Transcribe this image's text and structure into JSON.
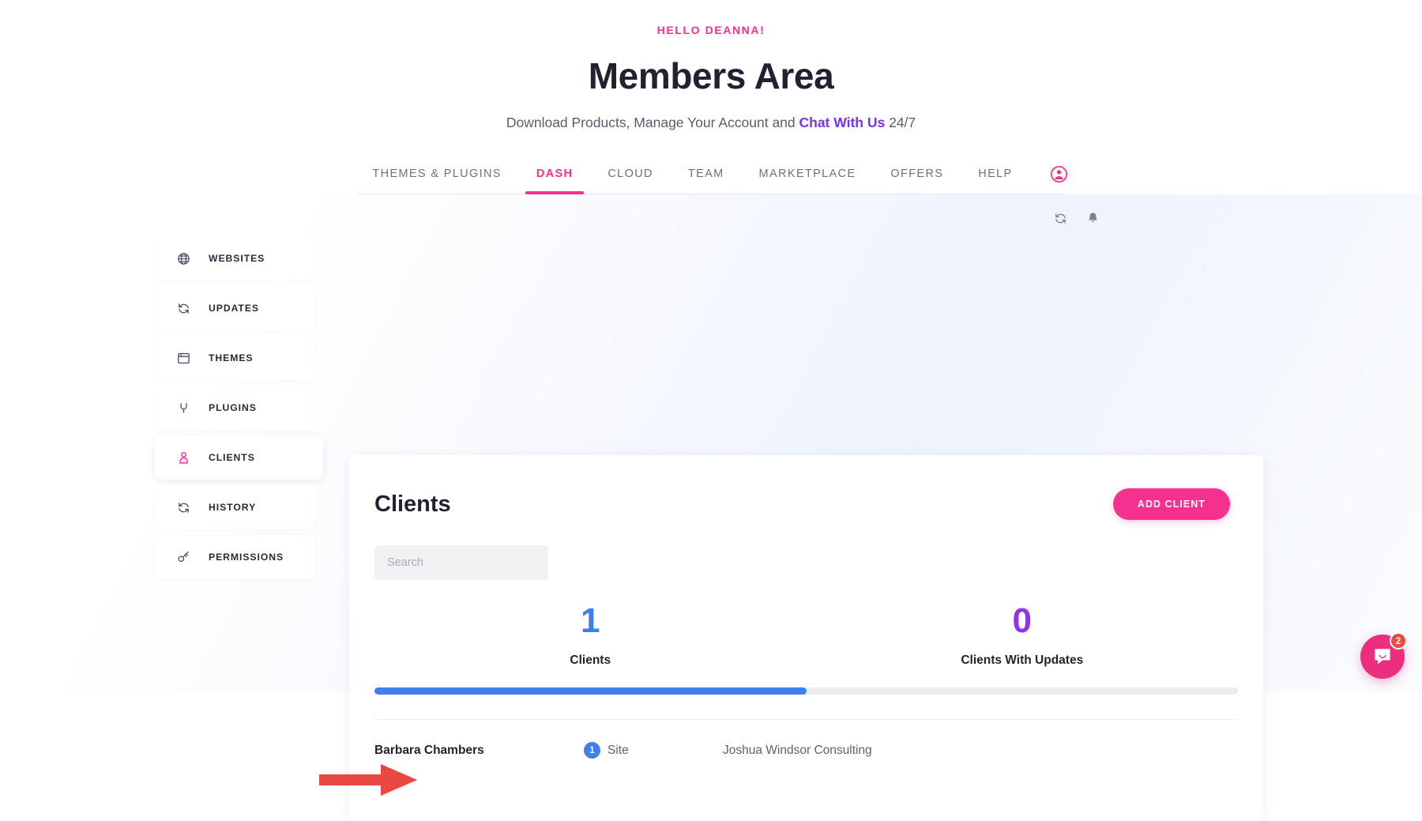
{
  "hero": {
    "greeting": "HELLO DEANNA!",
    "title": "Members Area",
    "subtitle_before": "Download Products, Manage Your Account and ",
    "chat_link": "Chat With Us",
    "subtitle_after": " 24/7"
  },
  "nav": {
    "tabs": [
      {
        "label": "THEMES & PLUGINS",
        "active": false
      },
      {
        "label": "DASH",
        "active": true
      },
      {
        "label": "CLOUD",
        "active": false
      },
      {
        "label": "TEAM",
        "active": false
      },
      {
        "label": "MARKETPLACE",
        "active": false
      },
      {
        "label": "OFFERS",
        "active": false
      },
      {
        "label": "HELP",
        "active": false
      }
    ],
    "avatar_icon": "account-circle-icon"
  },
  "toolbar": {
    "refresh_icon": "refresh-icon",
    "notifications_icon": "bell-icon"
  },
  "sidebar": {
    "items": [
      {
        "label": "WEBSITES",
        "icon": "globe-icon",
        "active": false
      },
      {
        "label": "UPDATES",
        "icon": "refresh-icon",
        "active": false
      },
      {
        "label": "THEMES",
        "icon": "window-icon",
        "active": false
      },
      {
        "label": "PLUGINS",
        "icon": "plug-icon",
        "active": false
      },
      {
        "label": "CLIENTS",
        "icon": "person-icon",
        "active": true
      },
      {
        "label": "HISTORY",
        "icon": "refresh-icon",
        "active": false
      },
      {
        "label": "PERMISSIONS",
        "icon": "key-icon",
        "active": false
      }
    ]
  },
  "main": {
    "title": "Clients",
    "add_button": "ADD CLIENT",
    "search_placeholder": "Search",
    "search_value": "",
    "stats": [
      {
        "value": "1",
        "label": "Clients",
        "color": "#3b7ff0"
      },
      {
        "value": "0",
        "label": "Clients With Updates",
        "color": "#9333e8"
      }
    ],
    "progress_percent": 50,
    "clients": [
      {
        "name": "Barbara Chambers",
        "site_count": "1",
        "sites_label": "Site",
        "company": "Joshua Windsor Consulting"
      }
    ]
  },
  "annotation": {
    "arrow_color": "#e8483f",
    "points_at": "Barbara Chambers"
  },
  "chat_widget": {
    "unread_count": "2",
    "icon": "chat-bubble-icon"
  },
  "colors": {
    "brand_pink": "#f5308f",
    "accent_blue": "#3b7ff0",
    "accent_purple": "#9333e8",
    "chat_pink": "#ed2d7e"
  }
}
